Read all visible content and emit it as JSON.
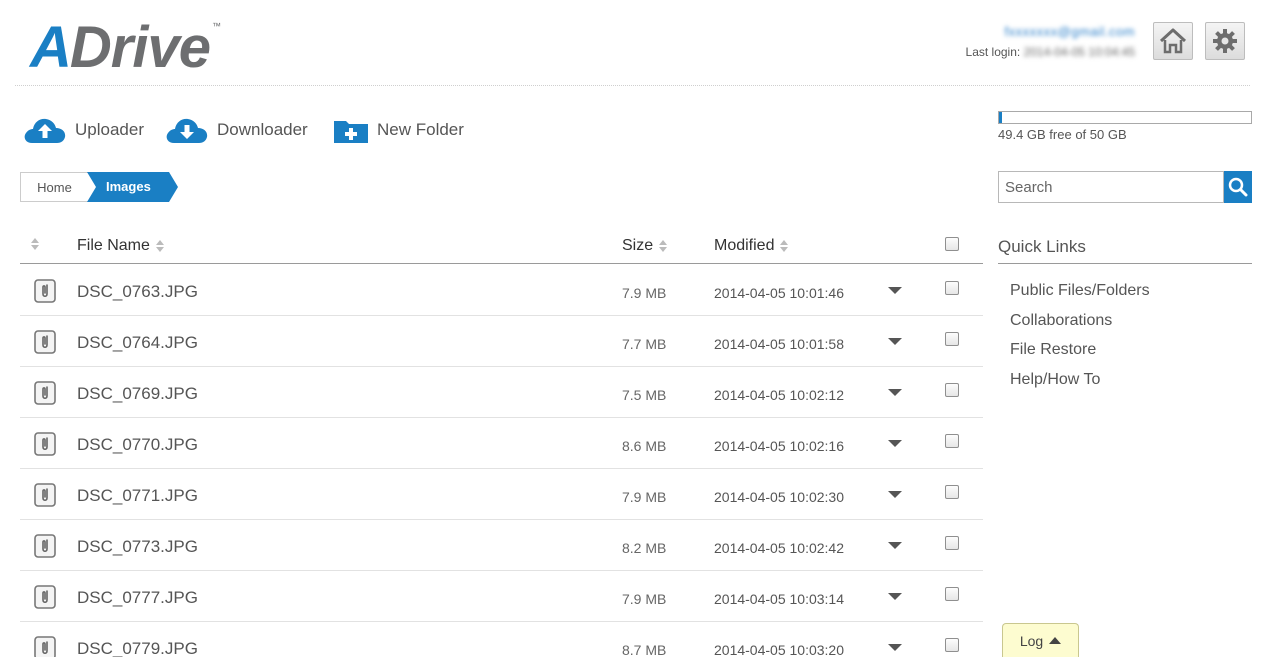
{
  "header": {
    "logo_a": "A",
    "logo_drive": "Drive",
    "logo_tm": "™",
    "user_email": "fxxxxxxx@gmail.com",
    "last_login_label": "Last login:",
    "last_login_value": "2014-04-05 10:04:45"
  },
  "toolbar": {
    "uploader": "Uploader",
    "downloader": "Downloader",
    "new_folder": "New Folder"
  },
  "storage": {
    "text": "49.4 GB free of 50 GB",
    "used_fraction": 0.012,
    "accent_color": "#1a7fc4"
  },
  "breadcrumb": {
    "home": "Home",
    "current": "Images"
  },
  "search": {
    "placeholder": "Search"
  },
  "table": {
    "headers": {
      "file_name": "File Name",
      "size": "Size",
      "modified": "Modified"
    },
    "rows": [
      {
        "name": "DSC_0763.JPG",
        "size": "7.9 MB",
        "modified": "2014-04-05 10:01:46"
      },
      {
        "name": "DSC_0764.JPG",
        "size": "7.7 MB",
        "modified": "2014-04-05 10:01:58"
      },
      {
        "name": "DSC_0769.JPG",
        "size": "7.5 MB",
        "modified": "2014-04-05 10:02:12"
      },
      {
        "name": "DSC_0770.JPG",
        "size": "8.6 MB",
        "modified": "2014-04-05 10:02:16"
      },
      {
        "name": "DSC_0771.JPG",
        "size": "7.9 MB",
        "modified": "2014-04-05 10:02:30"
      },
      {
        "name": "DSC_0773.JPG",
        "size": "8.2 MB",
        "modified": "2014-04-05 10:02:42"
      },
      {
        "name": "DSC_0777.JPG",
        "size": "7.9 MB",
        "modified": "2014-04-05 10:03:14"
      },
      {
        "name": "DSC_0779.JPG",
        "size": "8.7 MB",
        "modified": "2014-04-05 10:03:20"
      }
    ]
  },
  "quick_links": {
    "title": "Quick Links",
    "items": [
      "Public Files/Folders",
      "Collaborations",
      "File Restore",
      "Help/How To"
    ]
  },
  "log": {
    "label": "Log"
  }
}
